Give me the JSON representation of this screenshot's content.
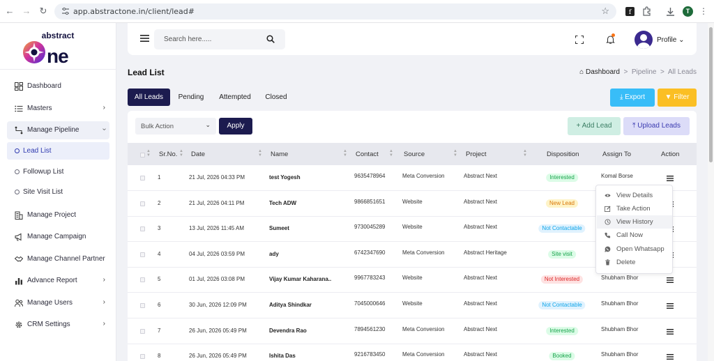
{
  "browser": {
    "url": "app.abstractone.in/client/lead#",
    "profile_initial": "T"
  },
  "brand": {
    "line1": "abstract",
    "line2": "one"
  },
  "sidebar": {
    "items": [
      {
        "label": "Dashboard",
        "icon": "dashboard-icon"
      },
      {
        "label": "Masters",
        "icon": "list-icon"
      },
      {
        "label": "Manage Pipeline",
        "icon": "pipeline-icon"
      },
      {
        "label": "Manage Project",
        "icon": "building-icon"
      },
      {
        "label": "Manage Campaign",
        "icon": "megaphone-icon"
      },
      {
        "label": "Manage Channel Partner",
        "icon": "handshake-icon"
      },
      {
        "label": "Advance Report",
        "icon": "bar-chart-icon"
      },
      {
        "label": "Manage Users",
        "icon": "users-icon"
      },
      {
        "label": "CRM Settings",
        "icon": "gear-icon"
      }
    ],
    "subitems": [
      {
        "label": "Lead List"
      },
      {
        "label": "Followup List"
      },
      {
        "label": "Site Visit List"
      }
    ]
  },
  "topbar": {
    "search_placeholder": "Search here.....",
    "profile_label": "Profile"
  },
  "page": {
    "title": "Lead List",
    "breadcrumb": [
      "Dashboard",
      "Pipeline",
      "All Leads"
    ]
  },
  "tabs": [
    "All Leads",
    "Pending",
    "Attempted",
    "Closed"
  ],
  "buttons": {
    "export": "Export",
    "filter": "Filter",
    "bulk_action": "Bulk Action",
    "apply": "Apply",
    "add_lead": "+ Add Lead",
    "upload_leads": "Upload Leads"
  },
  "table": {
    "columns": [
      "Sr.No.",
      "Date",
      "Name",
      "Contact",
      "Source",
      "Project",
      "Disposition",
      "Assign To",
      "Action"
    ],
    "rows": [
      {
        "sr": "1",
        "date": "21 Jul, 2026 04:33 PM",
        "name": "test Yogesh",
        "contact": "9635478964",
        "source": "Meta Conversion",
        "project": "Abstract Next",
        "disposition": "Interested",
        "assign": "Komal Borse"
      },
      {
        "sr": "2",
        "date": "21 Jul, 2026 04:11 PM",
        "name": "Tech ADW",
        "contact": "9866851651",
        "source": "Website",
        "project": "Abstract Next",
        "disposition": "New Lead",
        "assign": ""
      },
      {
        "sr": "3",
        "date": "13 Jul, 2026 11:45 AM",
        "name": "Sumeet",
        "contact": "9730045289",
        "source": "Website",
        "project": "Abstract Next",
        "disposition": "Not Contactable",
        "assign": ""
      },
      {
        "sr": "4",
        "date": "04 Jul, 2026 03:59 PM",
        "name": "ady",
        "contact": "6742347690",
        "source": "Meta Conversion",
        "project": "Abstract Heritage",
        "disposition": "Site visit",
        "assign": ""
      },
      {
        "sr": "5",
        "date": "01 Jul, 2026 03:08 PM",
        "name": "Vijay Kumar Kaharana..",
        "contact": "9967783243",
        "source": "Website",
        "project": "Abstract Next",
        "disposition": "Not Interested",
        "assign": "Shubham Bhor"
      },
      {
        "sr": "6",
        "date": "30 Jun, 2026 12:09 PM",
        "name": "Aditya Shindkar",
        "contact": "7045000646",
        "source": "Website",
        "project": "Abstract Next",
        "disposition": "Not Contactable",
        "assign": "Shubham Bhor"
      },
      {
        "sr": "7",
        "date": "26 Jun, 2026 05:49 PM",
        "name": "Devendra Rao",
        "contact": "7894561230",
        "source": "Meta Conversion",
        "project": "Abstract Next",
        "disposition": "Interested",
        "assign": "Shubham Bhor"
      },
      {
        "sr": "8",
        "date": "26 Jun, 2026 05:49 PM",
        "name": "Ishita Das",
        "contact": "9216783450",
        "source": "Meta Conversion",
        "project": "Abstract Next",
        "disposition": "Booked",
        "assign": "Shubham Bhor"
      }
    ]
  },
  "action_menu": [
    "View Details",
    "Take Action",
    "View History",
    "Call Now",
    "Open Whatsapp",
    "Delete"
  ],
  "colors": {
    "primary": "#1c1b4f",
    "export": "#38bdf8",
    "filter": "#fbbf24",
    "interested": "#16a34a",
    "new_lead": "#d97706",
    "not_contactable": "#0ea5e9",
    "not_interested": "#dc2626"
  }
}
